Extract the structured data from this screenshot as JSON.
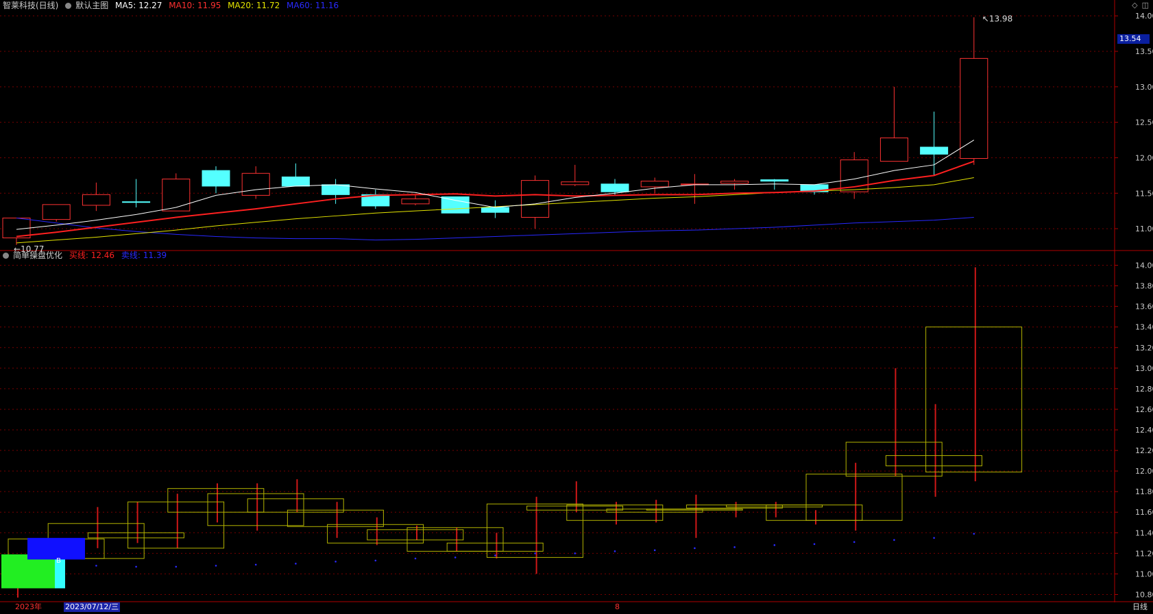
{
  "main_header": {
    "stock_name": "智莱科技(日线)",
    "chart_name": "默认主图",
    "ma5": "MA5: 12.27",
    "ma10": "MA10: 11.95",
    "ma20": "MA20: 11.72",
    "ma60": "MA60: 11.16"
  },
  "sub_header": {
    "indicator_name": "简单操盘优化",
    "buy_line": "买线: 12.46",
    "sell_line": "卖线: 11.39"
  },
  "colors": {
    "background": "#000000",
    "up": "#ff3232",
    "down": "#54ffff",
    "ma5": "#ffffff",
    "ma10": "#ff2020",
    "ma20": "#e6e600",
    "ma60": "#2828ff",
    "grid": "#7a0000",
    "axis_line": "#b00000",
    "sub_box": "#b3b300"
  },
  "right_axis_top": [
    "14.00",
    "13.50",
    "13.00",
    "12.50",
    "12.00",
    "11.50",
    "11.00"
  ],
  "right_axis_bottom": [
    "14.00",
    "13.80",
    "13.60",
    "13.40",
    "13.20",
    "13.00",
    "12.80",
    "12.60",
    "12.40",
    "12.20",
    "12.00",
    "11.80",
    "11.60",
    "11.40",
    "11.20",
    "11.00",
    "10.80"
  ],
  "current_price_tag": "13.54",
  "high_marker": "13.98",
  "low_marker": "10.77",
  "bottom_bar": {
    "year": "2023年",
    "cursor_date": "2023/07/12/三",
    "month": "8",
    "period_tab": "日线"
  },
  "buy_marker": "B",
  "icons": [
    "diamond-icon",
    "window-icon"
  ],
  "chart_data": {
    "type": "candlestick",
    "ylim_top": [
      10.75,
      14.05
    ],
    "ylim_bottom": [
      10.75,
      14.05
    ],
    "candles": [
      {
        "open": 10.87,
        "close": 11.15,
        "high": 11.15,
        "low": 10.77
      },
      {
        "open": 11.13,
        "close": 11.34,
        "high": 11.34,
        "low": 11.1
      },
      {
        "open": 11.33,
        "close": 11.48,
        "high": 11.65,
        "low": 11.25
      },
      {
        "open": 11.38,
        "close": 11.37,
        "high": 11.7,
        "low": 11.3
      },
      {
        "open": 11.25,
        "close": 11.7,
        "high": 11.78,
        "low": 11.25
      },
      {
        "open": 11.82,
        "close": 11.6,
        "high": 11.88,
        "low": 11.5
      },
      {
        "open": 11.47,
        "close": 11.78,
        "high": 11.88,
        "low": 11.42
      },
      {
        "open": 11.73,
        "close": 11.6,
        "high": 11.92,
        "low": 11.6
      },
      {
        "open": 11.62,
        "close": 11.48,
        "high": 11.7,
        "low": 11.35
      },
      {
        "open": 11.48,
        "close": 11.32,
        "high": 11.55,
        "low": 11.28
      },
      {
        "open": 11.35,
        "close": 11.42,
        "high": 11.47,
        "low": 11.33
      },
      {
        "open": 11.45,
        "close": 11.22,
        "high": 11.45,
        "low": 11.22
      },
      {
        "open": 11.3,
        "close": 11.23,
        "high": 11.4,
        "low": 11.15
      },
      {
        "open": 11.16,
        "close": 11.68,
        "high": 11.75,
        "low": 11.0
      },
      {
        "open": 11.62,
        "close": 11.66,
        "high": 11.9,
        "low": 11.6
      },
      {
        "open": 11.63,
        "close": 11.52,
        "high": 11.7,
        "low": 11.48
      },
      {
        "open": 11.59,
        "close": 11.67,
        "high": 11.72,
        "low": 11.5
      },
      {
        "open": 11.62,
        "close": 11.63,
        "high": 11.77,
        "low": 11.35
      },
      {
        "open": 11.64,
        "close": 11.67,
        "high": 11.7,
        "low": 11.55
      },
      {
        "open": 11.69,
        "close": 11.67,
        "high": 11.7,
        "low": 11.55
      },
      {
        "open": 11.62,
        "close": 11.52,
        "high": 11.62,
        "low": 11.48
      },
      {
        "open": 11.52,
        "close": 11.97,
        "high": 12.08,
        "low": 11.42
      },
      {
        "open": 11.95,
        "close": 12.28,
        "high": 13.0,
        "low": 11.95
      },
      {
        "open": 12.15,
        "close": 12.05,
        "high": 12.65,
        "low": 11.75
      },
      {
        "open": 11.99,
        "close": 13.4,
        "high": 13.98,
        "low": 11.9
      }
    ],
    "ma5": [
      10.99,
      11.05,
      11.12,
      11.2,
      11.3,
      11.47,
      11.55,
      11.6,
      11.62,
      11.56,
      11.51,
      11.4,
      11.3,
      11.35,
      11.44,
      11.5,
      11.57,
      11.62,
      11.62,
      11.63,
      11.62,
      11.7,
      11.82,
      11.9,
      12.25
    ],
    "ma10": [
      10.89,
      10.95,
      11.02,
      11.09,
      11.16,
      11.22,
      11.28,
      11.35,
      11.42,
      11.47,
      11.48,
      11.49,
      11.46,
      11.48,
      11.46,
      11.47,
      11.48,
      11.48,
      11.5,
      11.51,
      11.53,
      11.59,
      11.68,
      11.75,
      11.95
    ],
    "ma20": [
      10.8,
      10.84,
      10.88,
      10.93,
      10.98,
      11.04,
      11.09,
      11.14,
      11.18,
      11.22,
      11.25,
      11.28,
      11.31,
      11.34,
      11.37,
      11.4,
      11.43,
      11.45,
      11.48,
      11.51,
      11.53,
      11.55,
      11.58,
      11.62,
      11.72
    ],
    "ma60": [
      11.15,
      11.08,
      11.01,
      10.96,
      10.92,
      10.89,
      10.87,
      10.86,
      10.86,
      10.84,
      10.85,
      10.87,
      10.89,
      10.91,
      10.93,
      10.95,
      10.97,
      10.98,
      11.0,
      11.02,
      11.05,
      11.08,
      11.1,
      11.12,
      11.16
    ],
    "sub_boxes": [
      {
        "top": 11.34,
        "bottom": 11.15
      },
      {
        "top": 11.49,
        "bottom": 11.15
      },
      {
        "top": 11.4,
        "bottom": 11.35
      },
      {
        "top": 11.7,
        "bottom": 11.25
      },
      {
        "top": 11.83,
        "bottom": 11.6
      },
      {
        "top": 11.78,
        "bottom": 11.47
      },
      {
        "top": 11.73,
        "bottom": 11.6
      },
      {
        "top": 11.62,
        "bottom": 11.46
      },
      {
        "top": 11.48,
        "bottom": 11.3
      },
      {
        "top": 11.43,
        "bottom": 11.33
      },
      {
        "top": 11.45,
        "bottom": 11.22
      },
      {
        "top": 11.3,
        "bottom": 11.22
      },
      {
        "top": 11.68,
        "bottom": 11.16
      },
      {
        "top": 11.66,
        "bottom": 11.62
      },
      {
        "top": 11.67,
        "bottom": 11.52
      },
      {
        "top": 11.63,
        "bottom": 11.6
      },
      {
        "top": 11.63,
        "bottom": 11.62
      },
      {
        "top": 11.67,
        "bottom": 11.64
      },
      {
        "top": 11.67,
        "bottom": 11.65
      },
      {
        "top": 11.67,
        "bottom": 11.52
      },
      {
        "top": 11.97,
        "bottom": 11.52
      },
      {
        "top": 12.28,
        "bottom": 11.95
      },
      {
        "top": 12.15,
        "bottom": 12.05
      },
      {
        "top": 13.4,
        "bottom": 11.99
      }
    ],
    "sell_dots": [
      11.08,
      11.07,
      11.07,
      11.08,
      11.09,
      11.1,
      11.12,
      11.13,
      11.15,
      11.16,
      11.18,
      11.2,
      11.2,
      11.22,
      11.23,
      11.25,
      11.26,
      11.28,
      11.29,
      11.31,
      11.33,
      11.35,
      11.39
    ]
  }
}
